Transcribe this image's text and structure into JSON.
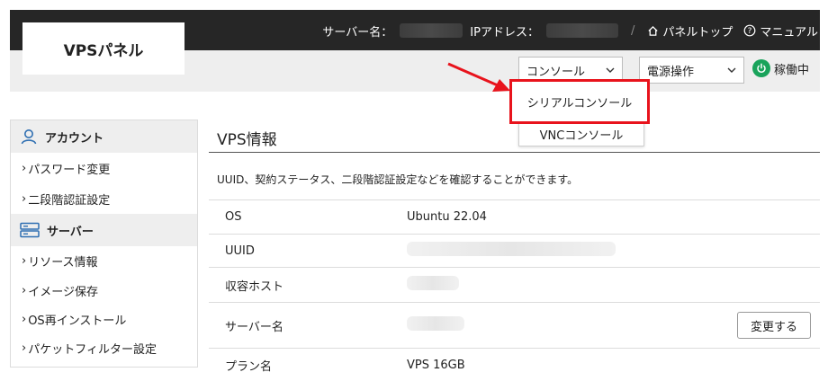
{
  "header": {
    "logo": "VPSパネル",
    "server_name_label": "サーバー名：",
    "ip_label": "IPアドレス：",
    "separator": "/",
    "panel_top": "パネルトップ",
    "manual": "マニュアル"
  },
  "toolbar": {
    "console_select": "コンソール",
    "power_select": "電源操作",
    "status": "稼働中",
    "status_color": "#19a35b"
  },
  "dropdown": {
    "items": [
      "シリアルコンソール",
      "VNCコンソール"
    ],
    "highlight_color": "#e8131c"
  },
  "sidebar": {
    "sections": [
      {
        "title": "アカウント",
        "items": [
          "パスワード変更",
          "二段階認証設定"
        ]
      },
      {
        "title": "サーバー",
        "items": [
          "リソース情報",
          "イメージ保存",
          "OS再インストール",
          "パケットフィルター設定"
        ]
      }
    ]
  },
  "main": {
    "title": "VPS情報",
    "description": "UUID、契約ステータス、二段階認証設定などを確認することができます。",
    "rows": [
      {
        "key": "OS",
        "value": "Ubuntu 22.04"
      },
      {
        "key": "UUID",
        "value": ""
      },
      {
        "key": "収容ホスト",
        "value": ""
      },
      {
        "key": "サーバー名",
        "value": "",
        "button": "変更する"
      },
      {
        "key": "プラン名",
        "value": "VPS 16GB"
      }
    ]
  }
}
